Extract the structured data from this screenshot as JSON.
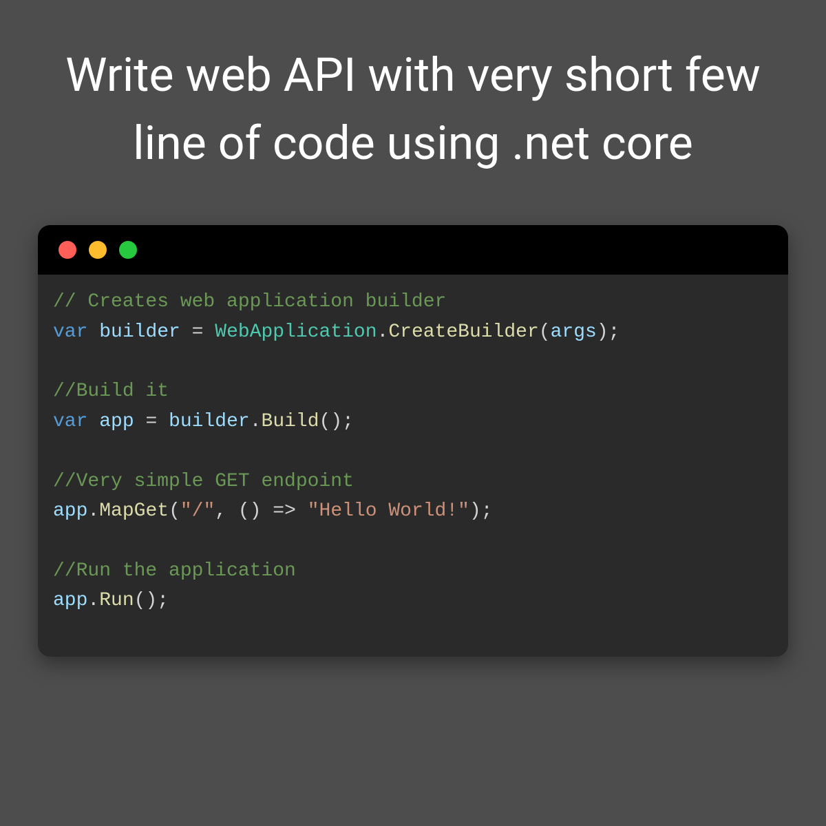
{
  "title": "Write web API with very short few line of code using .net core",
  "window": {
    "dots": [
      "red",
      "yellow",
      "green"
    ]
  },
  "code": {
    "c1": "// Creates web application builder",
    "l1": {
      "var": "var",
      "sp": " ",
      "builder": "builder",
      "eq": " = ",
      "type": "WebApplication",
      "dot": ".",
      "method": "CreateBuilder",
      "lp": "(",
      "arg": "args",
      "rp": ");"
    },
    "c2": "//Build it",
    "l2": {
      "var": "var",
      "sp": " ",
      "app": "app",
      "eq": " = ",
      "builder": "builder",
      "dot": ".",
      "method": "Build",
      "paren": "();"
    },
    "c3": "//Very simple GET endpoint",
    "l3": {
      "app": "app",
      "dot": ".",
      "method": "MapGet",
      "lp": "(",
      "path": "\"/\"",
      "comma": ", () => ",
      "str": "\"Hello World!\"",
      "rp": ");"
    },
    "c4": "//Run the application",
    "l4": {
      "app": "app",
      "dot": ".",
      "method": "Run",
      "paren": "();"
    }
  }
}
